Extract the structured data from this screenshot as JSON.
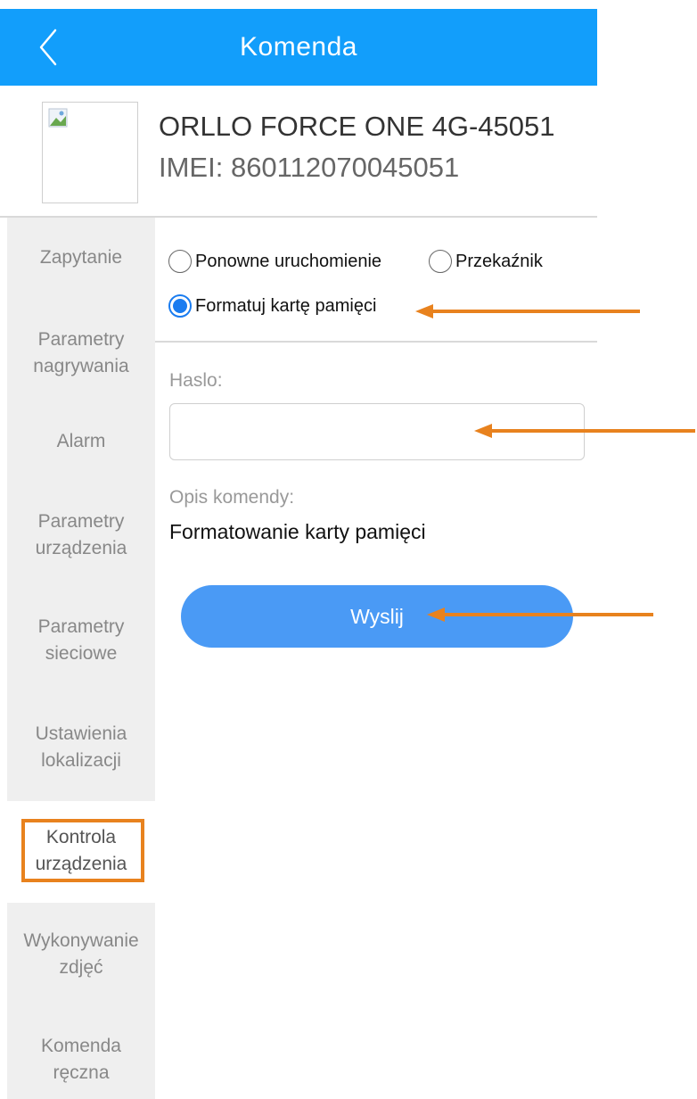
{
  "header": {
    "title": "Komenda",
    "back_icon": "chevron-left-icon"
  },
  "device": {
    "name": "ORLLO FORCE ONE 4G-45051",
    "imei": "IMEI:  860112070045051",
    "thumb_icon": "broken-image-icon"
  },
  "sidebar": {
    "items": [
      {
        "label": "Zapytanie"
      },
      {
        "label": "Parametry\nnagrywania"
      },
      {
        "label": "Alarm"
      },
      {
        "label": "Parametry\nurządzenia"
      },
      {
        "label": "Parametry\nsieciowe"
      },
      {
        "label": "Ustawienia\nlokalizacji"
      },
      {
        "label": "Kontrola\nurządzenia"
      },
      {
        "label": "Wykonywanie\nzdjęć"
      },
      {
        "label": "Komenda\nręczna"
      }
    ],
    "active_index": 6
  },
  "commands": {
    "options": [
      {
        "label": "Ponowne uruchomienie",
        "checked": false
      },
      {
        "label": "Przekaźnik",
        "checked": false
      },
      {
        "label": "Formatuj kartę pamięci",
        "checked": true
      }
    ]
  },
  "password": {
    "label": "Haslo:",
    "value": ""
  },
  "description": {
    "label": "Opis komendy:",
    "text": "Formatowanie karty pamięci"
  },
  "send_button": {
    "label": "Wyslij"
  },
  "colors": {
    "header_bg": "#129efb",
    "button_bg": "#4a9af5",
    "radio_checked": "#1a7cf0",
    "annotation": "#e8821e"
  }
}
